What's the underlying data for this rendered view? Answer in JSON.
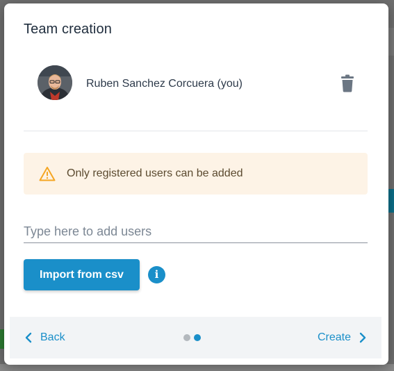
{
  "modal": {
    "title": "Team creation"
  },
  "members": [
    {
      "name": "Ruben Sanchez Corcuera (you)",
      "avatar_icon": "user-photo"
    }
  ],
  "warning": {
    "text": "Only registered users can be added",
    "icon": "warning-triangle-icon",
    "color": "#f5a623"
  },
  "add_users": {
    "placeholder": "Type here to add users",
    "value": ""
  },
  "import_button": {
    "label": "Import from csv"
  },
  "info_icon": {
    "glyph": "i"
  },
  "footer": {
    "back_label": "Back",
    "create_label": "Create",
    "steps_total": 2,
    "current_step": 2
  },
  "colors": {
    "accent": "#1a8fc9",
    "inactive_dot": "#b3b8bd",
    "warning_bg": "#fdf3e6"
  }
}
